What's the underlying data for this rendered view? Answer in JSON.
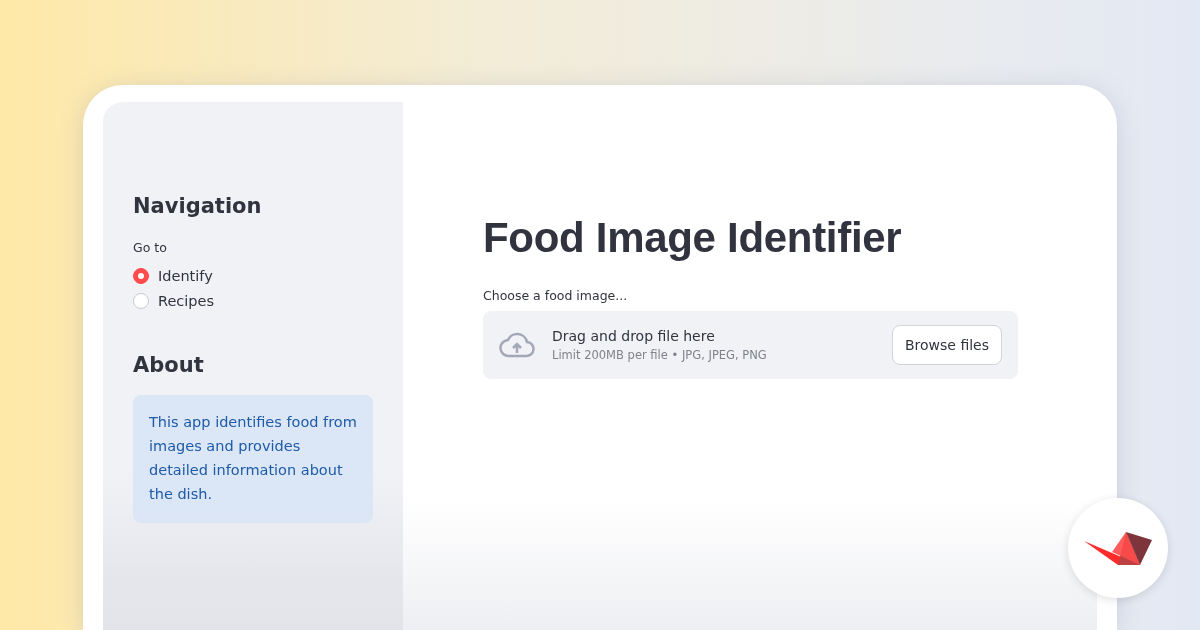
{
  "sidebar": {
    "title": "Navigation",
    "radio": {
      "label": "Go to",
      "options": [
        {
          "label": "Identify",
          "selected": true
        },
        {
          "label": "Recipes",
          "selected": false
        }
      ]
    },
    "about": {
      "title": "About",
      "info": "This app identifies food from images and provides detailed information about the dish."
    }
  },
  "main": {
    "title": "Food Image Identifier",
    "uploader": {
      "label": "Choose a food image...",
      "prompt": "Drag and drop file here",
      "limits": "Limit 200MB per file • JPG, JPEG, PNG",
      "button": "Browse files"
    }
  }
}
